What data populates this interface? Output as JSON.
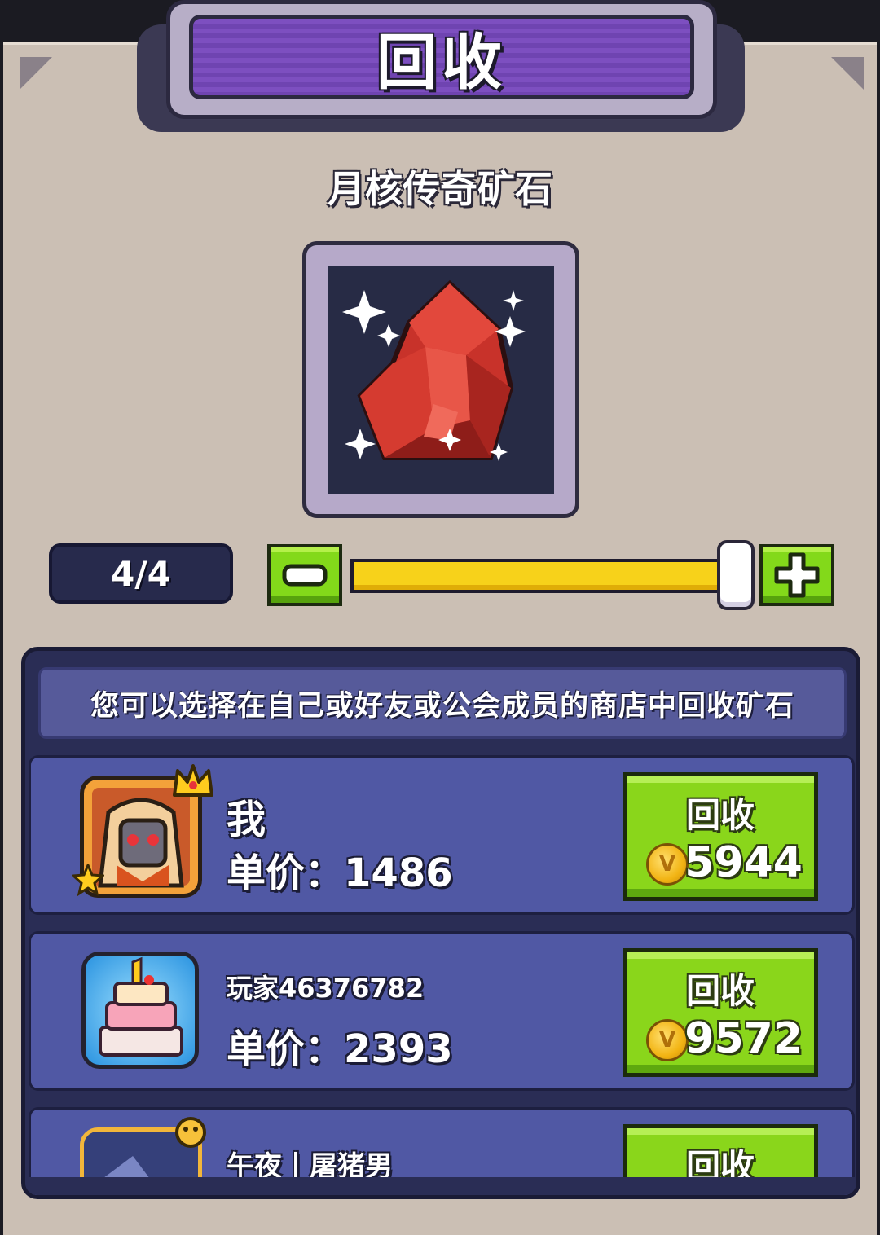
{
  "header": {
    "title": "回收"
  },
  "item": {
    "name": "月核传奇矿石",
    "icon": "red-gem-icon"
  },
  "quantity": {
    "display": "4/4",
    "current": 4,
    "max": 4,
    "fill_fraction": 1.0
  },
  "controls": {
    "minus_icon": "minus-icon",
    "plus_icon": "plus-icon"
  },
  "info": {
    "text": "您可以选择在自己或好友或公会成员的商店中回收矿石"
  },
  "shops": [
    {
      "name": "我",
      "price_label": "单价：",
      "price": "1486",
      "button_label": "回收",
      "total": "5944",
      "avatar": "robot-avatar"
    },
    {
      "name": "玩家46376782",
      "price_label": "单价：",
      "price": "2393",
      "button_label": "回收",
      "total": "9572",
      "avatar": "cake-avatar"
    },
    {
      "name": "午夜丨屠猪男",
      "price_label": "",
      "price": "",
      "button_label": "回收",
      "total": "",
      "avatar": "pig-avatar"
    }
  ],
  "colors": {
    "accent_green": "#8ad61b",
    "slider_yellow": "#f7d21a",
    "title_purple": "#7d4fc0",
    "row_blue": "#5058a4"
  }
}
